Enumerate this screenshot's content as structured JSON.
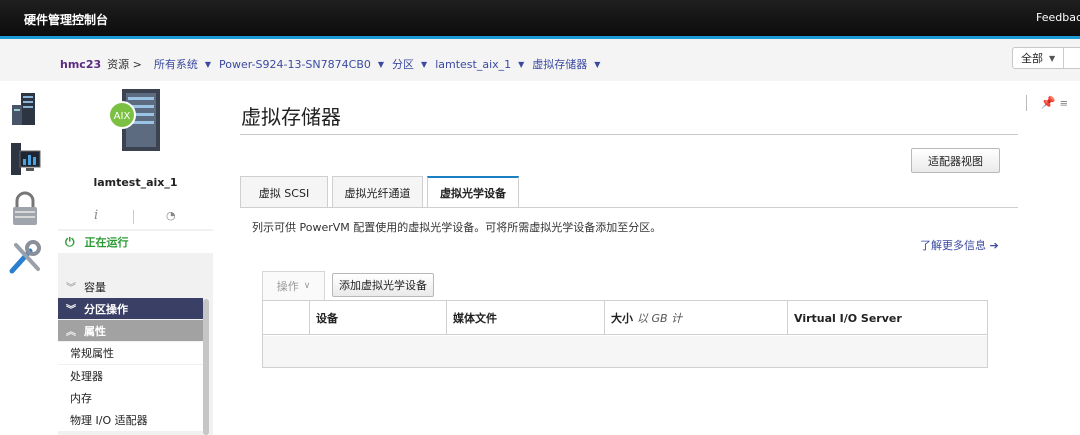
{
  "header": {
    "title": "硬件管理控制台",
    "feedback": "Feedback"
  },
  "breadcrumb": {
    "host": "hmc23",
    "resources": "资源 >",
    "links": [
      "所有系统",
      "Power-S924-13-SN7874CB0",
      "分区",
      "lamtest_aix_1",
      "虚拟存储器"
    ],
    "scope": "全部"
  },
  "iconstrip": [
    "server-icon",
    "monitor-chart-icon",
    "lock-icon",
    "tools-icon"
  ],
  "nav": {
    "badge": "AIX",
    "lpar_name": "lamtest_aix_1",
    "info_glyph": "i",
    "status": "正在运行",
    "sections": {
      "capacity": "容量",
      "partition_ops": "分区操作",
      "properties": "属性"
    },
    "items": [
      "常规属性",
      "处理器",
      "内存",
      "物理 I/O 适配器"
    ]
  },
  "main": {
    "title": "虚拟存储器",
    "adapter_view": "适配器视图",
    "tabs": [
      {
        "label": "虚拟 SCSI",
        "active": false
      },
      {
        "label": "虚拟光纤通道",
        "active": false
      },
      {
        "label": "虚拟光学设备",
        "active": true
      }
    ],
    "description": "列示可供 PowerVM 配置使用的虚拟光学设备。可将所需虚拟光学设备添加至分区。",
    "learn_more": "了解更多信息 ➔",
    "actions_label": "操作",
    "add_button": "添加虚拟光学设备",
    "table": {
      "columns": [
        "设备",
        "媒体文件",
        "大小",
        "Virtual I/O Server"
      ],
      "size_unit": "以 GB 计",
      "rows": []
    }
  },
  "colors": {
    "accent": "#1b9ad6",
    "nav_dark": "#3a3f66",
    "running": "#2b9a33",
    "link": "#3b4aa0"
  }
}
